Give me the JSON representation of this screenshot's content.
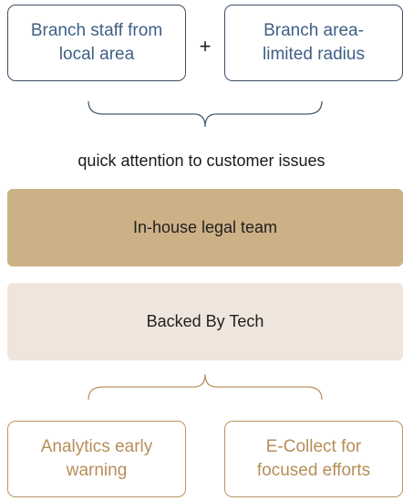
{
  "top": {
    "left_box": "Branch staff from local area",
    "operator": "+",
    "right_box": "Branch area-limited radius"
  },
  "caption": "quick attention to customer issues",
  "bands": {
    "legal": "In-house legal team",
    "tech": "Backed By Tech"
  },
  "bottom": {
    "left_box": "Analytics early warning",
    "right_box": "E-Collect for focused efforts"
  },
  "colors": {
    "top_border": "#3d4f66",
    "top_text": "#3f5f86",
    "legal_band": "#cdb186",
    "tech_band": "#efe5dc",
    "bottom_border": "#b8955f",
    "bottom_text": "#b58e58",
    "brace_top": "#4a5c72",
    "brace_bottom": "#b8955f"
  }
}
